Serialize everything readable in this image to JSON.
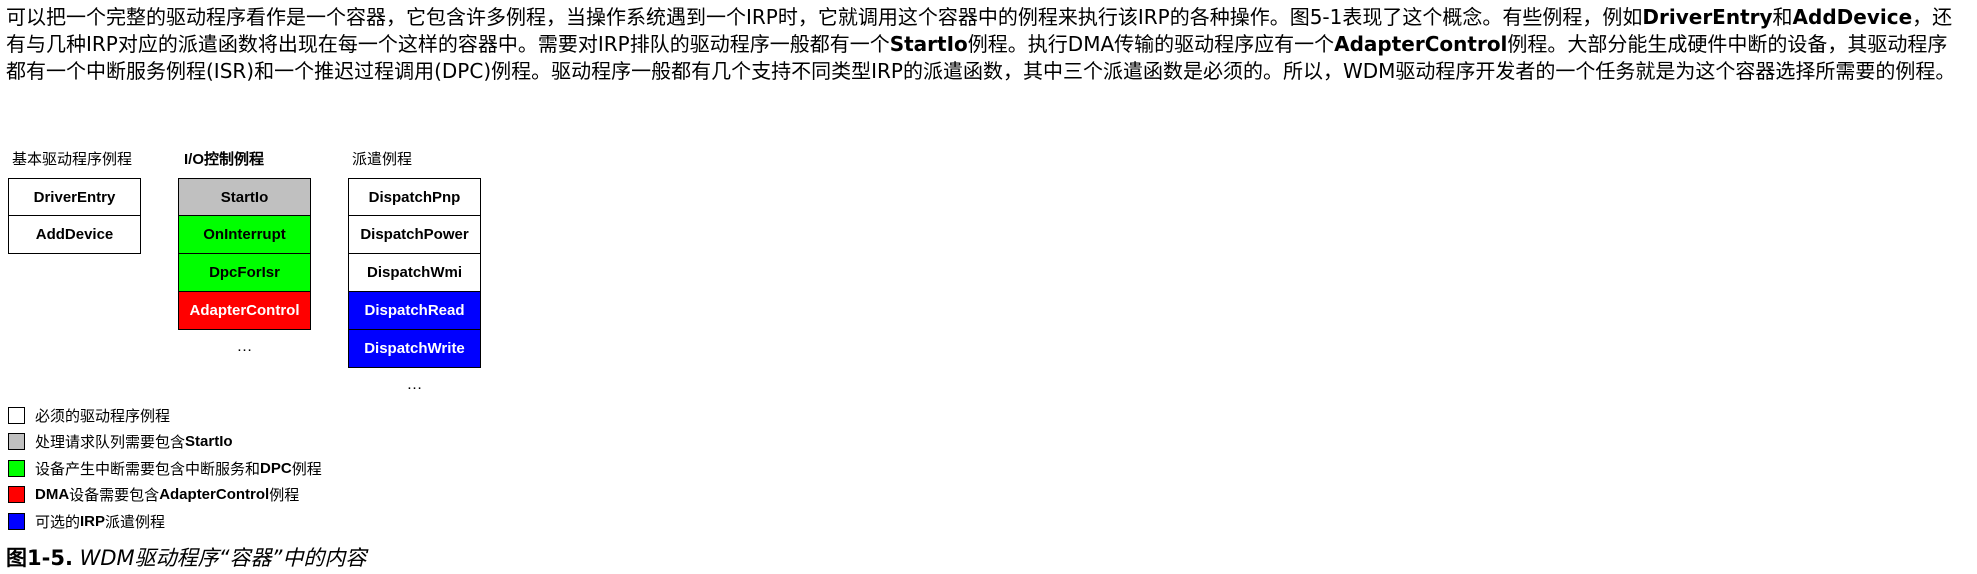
{
  "intro": {
    "s1": "可以把一个完整的驱动程序看作是一个容器，它包含许多例程，当操作系统遇到一个IRP时，它就调用这个容器中的例程来执行该IRP的各种操作。图5-1表现了这个概念。有些例程，例如",
    "b1": "DriverEntry",
    "s2": "和",
    "b2": "AddDevice",
    "s3": "，还有与几种IRP对应的派遣函数将出现在每一个这样的容器中。需要对IRP排队的驱动程序一般都有一个",
    "b3": "StartIo",
    "s4": "例程。执行DMA传输的驱动程序应有一个",
    "b4": "AdapterControl",
    "s5": "例程。大部分能生成硬件中断的设备，其驱动程序都有一个中断服务例程(ISR)和一个推迟过程调用(DPC)例程。驱动程序一般都有几个支持不同类型IRP的派遣函数，其中三个派遣函数是必须的。所以，WDM驱动程序开发者的一个任务就是为这个容器选择所需要的例程。"
  },
  "colors": {
    "required": "#ffffff",
    "queue": "#c0c0c0",
    "interrupt": "#00ff00",
    "dma": "#ff0000",
    "optional": "#0000ff"
  },
  "columns": {
    "basic": {
      "heading": "基本驱动程序例程",
      "items": [
        {
          "label": "DriverEntry",
          "color": "#ffffff",
          "text_color": "#000000"
        },
        {
          "label": "AddDevice",
          "color": "#ffffff",
          "text_color": "#000000"
        }
      ]
    },
    "io": {
      "heading": "I/O控制例程",
      "items": [
        {
          "label": "StartIo",
          "color": "#c0c0c0",
          "text_color": "#000000"
        },
        {
          "label": "OnInterrupt",
          "color": "#00ff00",
          "text_color": "#000000"
        },
        {
          "label": "DpcForIsr",
          "color": "#00ff00",
          "text_color": "#000000"
        },
        {
          "label": "AdapterControl",
          "color": "#ff0000",
          "text_color": "#ffffff"
        }
      ],
      "more": "…"
    },
    "dispatch": {
      "heading": "派遣例程",
      "items": [
        {
          "label": "DispatchPnp",
          "color": "#ffffff",
          "text_color": "#000000"
        },
        {
          "label": "DispatchPower",
          "color": "#ffffff",
          "text_color": "#000000"
        },
        {
          "label": "DispatchWmi",
          "color": "#ffffff",
          "text_color": "#000000"
        },
        {
          "label": "DispatchRead",
          "color": "#0000ff",
          "text_color": "#ffffff"
        },
        {
          "label": "DispatchWrite",
          "color": "#0000ff",
          "text_color": "#ffffff"
        }
      ],
      "more": "…"
    }
  },
  "legend": [
    {
      "color": "#ffffff",
      "text": "必须的驱动程序例程",
      "bold": ""
    },
    {
      "color": "#c0c0c0",
      "text": "处理请求队列需要包含 ",
      "bold": "StartIo"
    },
    {
      "color": "#00ff00",
      "text": "设备产生中断需要包含中断服务和 ",
      "bold": "DPC",
      "after": "例程"
    },
    {
      "color": "#ff0000",
      "bold_lead": "DMA",
      "text": "设备需要包含 ",
      "bold": "AdapterControl",
      "after": "例程"
    },
    {
      "color": "#0000ff",
      "text": "可选的",
      "bold": "IRP",
      "after": "派遣例程"
    }
  ],
  "caption": {
    "lead": "图1-5.",
    "title": " WDM驱动程序“容器”中的内容"
  }
}
